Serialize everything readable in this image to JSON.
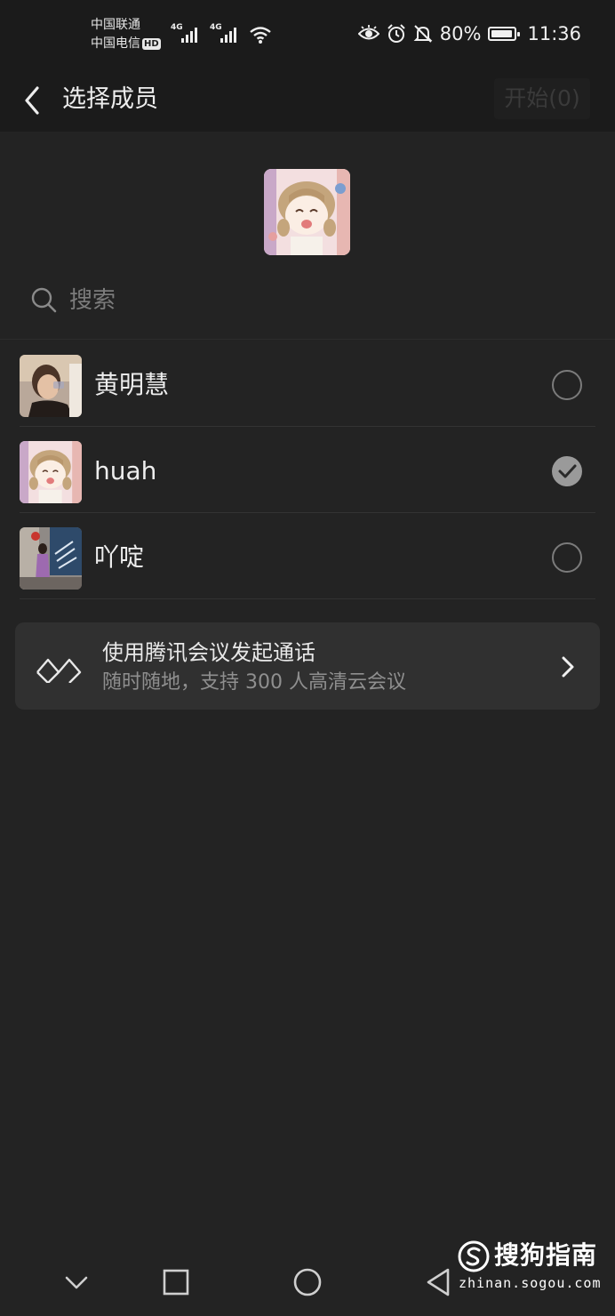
{
  "status_bar": {
    "carrier_1": "中国联通",
    "carrier_2": "中国电信",
    "hd_badge": "HD",
    "network_1": "4G",
    "network_2": "4G",
    "battery_percent": "80%",
    "battery_level": 0.8,
    "time": "11:36"
  },
  "header": {
    "title": "选择成员",
    "start_button": "开始(0)"
  },
  "search": {
    "placeholder": "搜索",
    "value": ""
  },
  "members": [
    {
      "name": "黄明慧",
      "selected": false
    },
    {
      "name": "huah",
      "selected": true
    },
    {
      "name": "吖啶",
      "selected": false
    }
  ],
  "meeting_card": {
    "title": "使用腾讯会议发起通话",
    "subtitle": "随时随地，支持 300 人高清云会议"
  },
  "watermark": {
    "brand": "搜狗指南",
    "url": "zhinan.sogou.com"
  },
  "colors": {
    "background": "#232323",
    "header": "#1b1b1b",
    "card": "#303030",
    "check_selected": "#9a9a9a"
  }
}
